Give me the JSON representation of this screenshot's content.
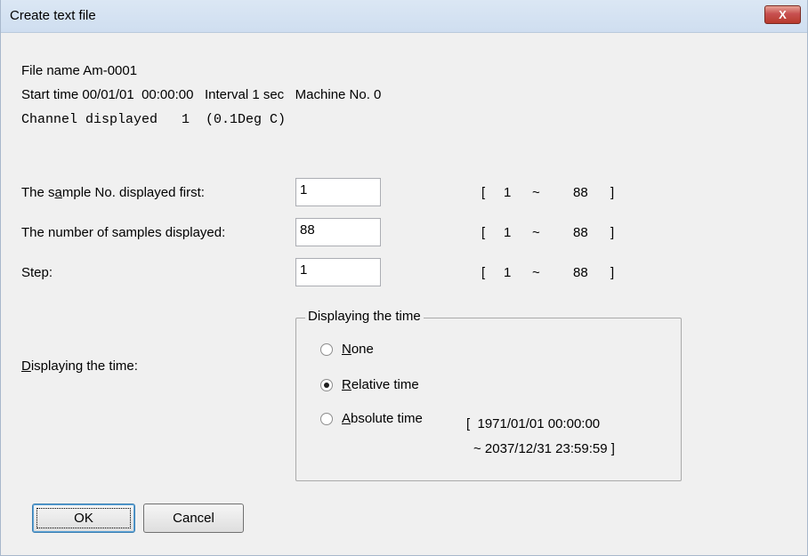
{
  "window": {
    "title": "Create text file",
    "close_label": "X"
  },
  "info": {
    "file_name": "File name Am-0001",
    "start_time": "Start time 00/01/01  00:00:00   Interval 1 sec   Machine No. 0",
    "channel": "Channel displayed   1  (0.1Deg C)"
  },
  "fields": {
    "first_sample": {
      "label_pre": "The s",
      "label_ul": "a",
      "label_post": "mple No. displayed first:",
      "value": "1",
      "range": {
        "open": "[",
        "min": "1",
        "sep": "~",
        "max": "88",
        "close": "]"
      }
    },
    "num_samples": {
      "label": "The number of samples displayed:",
      "value": "88",
      "range": {
        "open": "[",
        "min": "1",
        "sep": "~",
        "max": "88",
        "close": "]"
      }
    },
    "step": {
      "label": "Step:",
      "value": "1",
      "range": {
        "open": "[",
        "min": "1",
        "sep": "~",
        "max": "88",
        "close": "]"
      }
    }
  },
  "time_display": {
    "label_ul": "D",
    "label_post": "isplaying the time:",
    "group_title": "Displaying the time",
    "options": [
      {
        "label_ul": "N",
        "label_post": "one",
        "checked": false
      },
      {
        "label_ul": "R",
        "label_post": "elative time",
        "checked": true
      },
      {
        "label_ul": "A",
        "label_post": "bsolute time",
        "checked": false
      }
    ],
    "absolute_range_line1": "[  1971/01/01 00:00:00",
    "absolute_range_line2": "~ 2037/12/31 23:59:59 ]"
  },
  "buttons": {
    "ok": "OK",
    "cancel": "Cancel"
  }
}
